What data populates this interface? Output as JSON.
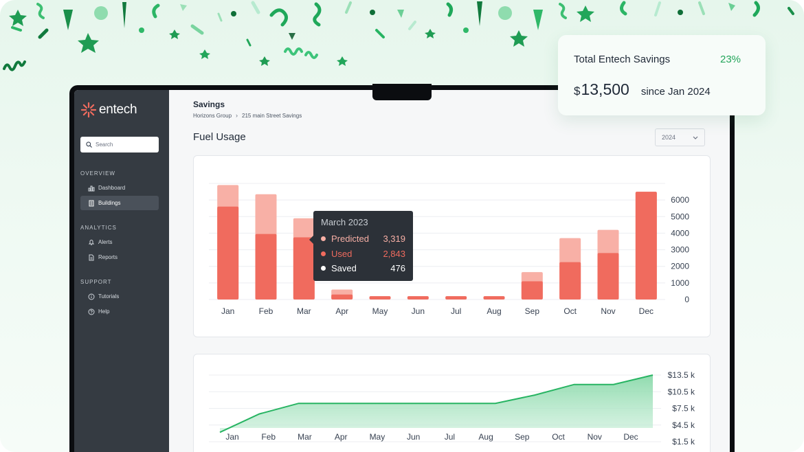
{
  "colors": {
    "predicted": "#f8b0a6",
    "used": "#f06b5e",
    "saved": "#ffffff",
    "savings_line": "#27b462",
    "savings_fill": "#8ad9aa",
    "sidebar_bg": "#353b42",
    "accent_green": "#23a55a"
  },
  "savings_card": {
    "title": "Total Entech Savings",
    "percent": "23%",
    "currency": "$",
    "amount": "13,500",
    "since": "since Jan 2024"
  },
  "sidebar": {
    "brand": "entech",
    "search_placeholder": "Search",
    "sections": [
      {
        "title": "OVERVIEW",
        "items": [
          {
            "label": "Dashboard",
            "icon": "bar-chart-icon",
            "active": false
          },
          {
            "label": "Buildings",
            "icon": "building-icon",
            "active": true
          }
        ]
      },
      {
        "title": "ANALYTICS",
        "items": [
          {
            "label": "Alerts",
            "icon": "bell-icon",
            "active": false
          },
          {
            "label": "Reports",
            "icon": "document-icon",
            "active": false
          }
        ]
      },
      {
        "title": "SUPPORT",
        "items": [
          {
            "label": "Tutorials",
            "icon": "info-circle-icon",
            "active": false
          },
          {
            "label": "Help",
            "icon": "help-circle-icon",
            "active": false
          }
        ]
      }
    ]
  },
  "header": {
    "title": "Savings",
    "breadcrumb": [
      "Horizons Group",
      "215 main Street Savings"
    ]
  },
  "fuel_section": {
    "title": "Fuel Usage",
    "year_selected": "2024"
  },
  "tooltip": {
    "title": "March 2023",
    "rows": [
      {
        "label": "Predicted",
        "value": "3,319"
      },
      {
        "label": "Used",
        "value": "2,843"
      },
      {
        "label": "Saved",
        "value": "476"
      }
    ]
  },
  "chart_data": [
    {
      "type": "bar",
      "categories": [
        "Jan",
        "Feb",
        "Mar",
        "Apr",
        "May",
        "Jun",
        "Jul",
        "Aug",
        "Sep",
        "Oct",
        "Nov",
        "Dec"
      ],
      "series": [
        {
          "name": "Predicted",
          "values": [
            6900,
            6350,
            4900,
            600,
            0,
            0,
            0,
            0,
            1650,
            3700,
            4200,
            6500
          ]
        },
        {
          "name": "Used",
          "values": [
            5600,
            3950,
            3750,
            300,
            200,
            200,
            200,
            200,
            1100,
            2250,
            2800,
            6500
          ]
        }
      ],
      "y_ticks": [
        0,
        1000,
        2000,
        3000,
        4000,
        5000,
        6000
      ],
      "ylim": [
        0,
        7000
      ],
      "axis_side": "right",
      "grid": true
    },
    {
      "type": "area",
      "categories": [
        "Jan",
        "Feb",
        "Mar",
        "Apr",
        "May",
        "Jun",
        "Jul",
        "Aug",
        "Sep",
        "Oct",
        "Nov",
        "Dec"
      ],
      "values": [
        3.2,
        6.5,
        8.4,
        8.4,
        8.4,
        8.4,
        8.4,
        8.4,
        9.9,
        11.8,
        11.8,
        13.5
      ],
      "y_ticks": [
        "$13.5 k",
        "$10.5 k",
        "$7.5 k",
        "$4.5 k",
        "$1.5 k"
      ],
      "y_tick_values": [
        13.5,
        10.5,
        7.5,
        4.5,
        1.5
      ],
      "ylim": [
        1.5,
        13.5
      ],
      "axis_side": "right",
      "grid": true
    }
  ]
}
